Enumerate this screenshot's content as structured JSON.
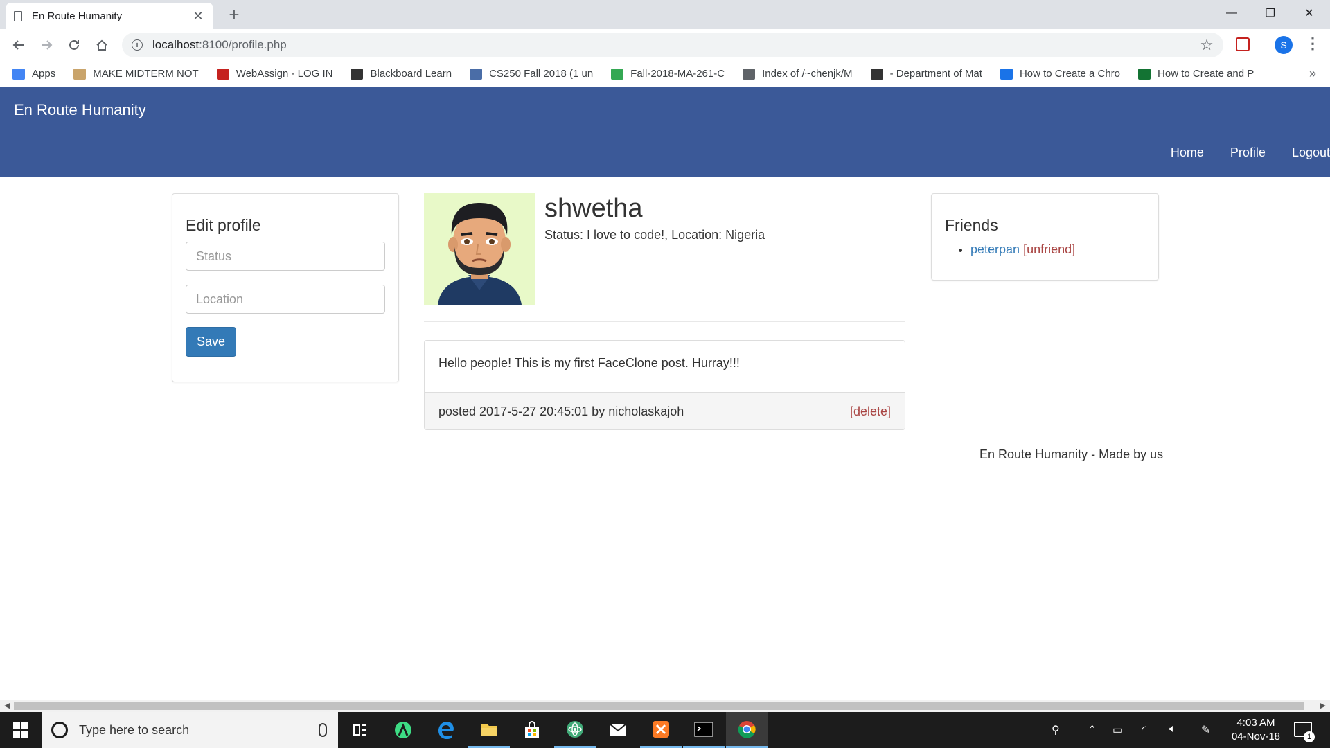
{
  "browser": {
    "tab_title": "En Route Humanity",
    "url_host": "localhost",
    "url_path": ":8100/profile.php",
    "profile_initial": "S",
    "bookmarks": [
      {
        "label": "Apps",
        "color": "#4285f4"
      },
      {
        "label": "MAKE MIDTERM NOT",
        "color": "#c9a46b"
      },
      {
        "label": "WebAssign - LOG IN",
        "color": "#c5221f"
      },
      {
        "label": "Blackboard Learn",
        "color": "#333333"
      },
      {
        "label": "CS250 Fall 2018 (1 un",
        "color": "#4a6da7"
      },
      {
        "label": "Fall-2018-MA-261-C",
        "color": "#34a853"
      },
      {
        "label": "Index of /~chenjk/M",
        "color": "#5f6368"
      },
      {
        "label": "- Department of Mat",
        "color": "#333333"
      },
      {
        "label": "How to Create a Chro",
        "color": "#1a73e8"
      },
      {
        "label": "How to Create and P",
        "color": "#137333"
      }
    ]
  },
  "site": {
    "brand": "En Route Humanity",
    "nav": [
      "Home",
      "Profile",
      "Logout"
    ],
    "accent": "#3b5998"
  },
  "edit_profile": {
    "title": "Edit profile",
    "status_placeholder": "Status",
    "location_placeholder": "Location",
    "save_label": "Save"
  },
  "profile": {
    "username": "shwetha",
    "status_line": "Status: I love to code!, Location: Nigeria"
  },
  "post": {
    "content": "Hello people! This is my first FaceClone post. Hurray!!!",
    "meta": "posted 2017-5-27 20:45:01 by nicholaskajoh",
    "delete_label": "[delete]"
  },
  "friends": {
    "title": "Friends",
    "items": [
      {
        "name": "peterpan",
        "action": "[unfriend]"
      }
    ]
  },
  "footer": "En Route Humanity - Made by us",
  "taskbar": {
    "search_placeholder": "Type here to search",
    "time": "4:03 AM",
    "date": "04-Nov-18",
    "notification_count": "1"
  }
}
